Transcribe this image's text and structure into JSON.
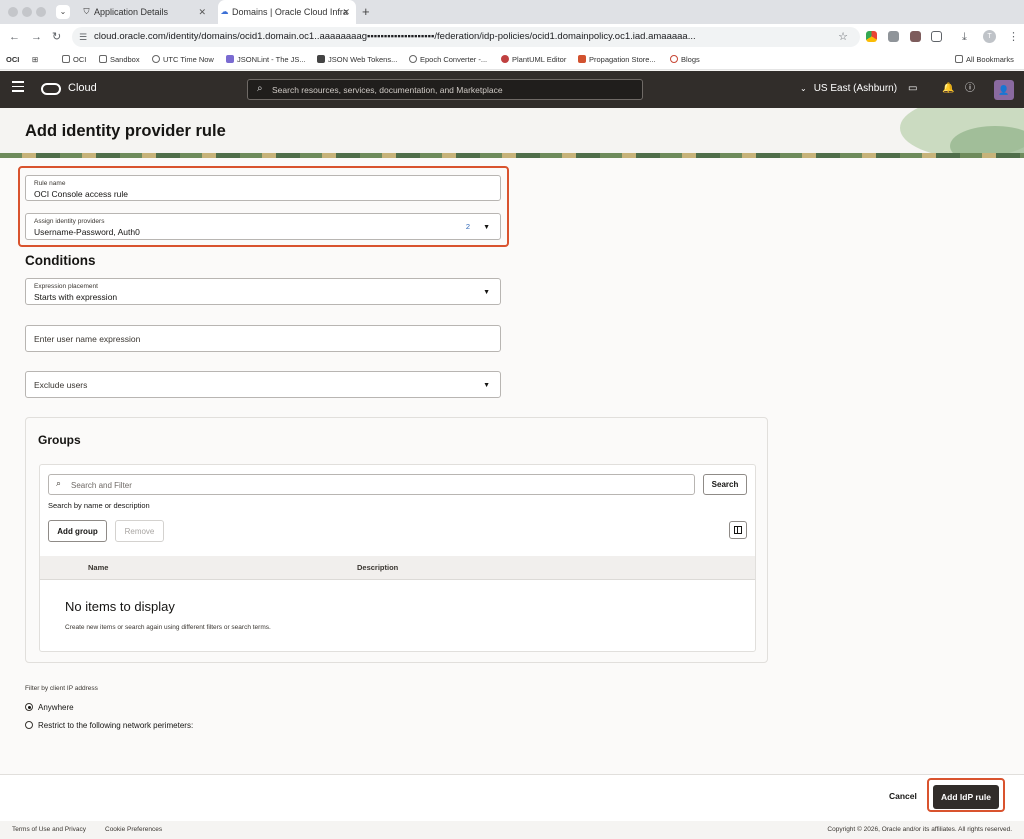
{
  "browser": {
    "tabs": [
      {
        "title": "Application Details",
        "icon": "shield-icon"
      },
      {
        "title": "Domains | Oracle Cloud Infra",
        "icon": "cloud-icon"
      }
    ],
    "url": "cloud.oracle.com/identity/domains/ocid1.domain.oc1..aaaaaaaag▪▪▪▪▪▪▪▪▪▪▪▪▪▪▪▪▪▪▪▪/federation/idp-policies/ocid1.domainpolicy.oc1.iad.amaaaaa...",
    "bookmarks": [
      "OCI",
      "Sandbox",
      "UTC Time Now",
      "JSONLint - The JS...",
      "JSON Web Tokens...",
      "Epoch Converter -...",
      "PlantUML Editor",
      "Propagation Store...",
      "Blogs"
    ],
    "all_bookmarks": "All Bookmarks",
    "oci_badge": "OCI"
  },
  "header": {
    "brand": "Cloud",
    "search_placeholder": "Search resources, services, documentation, and Marketplace",
    "region": "US East (Ashburn)"
  },
  "page": {
    "title": "Add identity provider rule"
  },
  "form": {
    "rule_name": {
      "label": "Rule name",
      "value": "OCI Console access rule"
    },
    "identity_providers": {
      "label": "Assign identity providers",
      "value": "Username-Password, Auth0",
      "count": "2"
    },
    "conditions_heading": "Conditions",
    "expression_placement": {
      "label": "Expression placement",
      "value": "Starts with expression"
    },
    "user_name_expression": {
      "placeholder": "Enter user name expression"
    },
    "exclude_users": {
      "placeholder": "Exclude users"
    }
  },
  "groups": {
    "heading": "Groups",
    "search_placeholder": "Search and Filter",
    "search_button": "Search",
    "hint": "Search by name or description",
    "add_button": "Add group",
    "remove_button": "Remove",
    "columns": [
      "Name",
      "Description"
    ],
    "empty_title": "No items to display",
    "empty_sub": "Create new items or search again using different filters or search terms."
  },
  "ip_filter": {
    "label": "Filter by client IP address",
    "options": [
      {
        "label": "Anywhere",
        "selected": true
      },
      {
        "label": "Restrict to the following network perimeters:",
        "selected": false
      }
    ]
  },
  "footer": {
    "cancel": "Cancel",
    "submit": "Add IdP rule",
    "terms": "Terms of Use and Privacy",
    "cookies": "Cookie Preferences",
    "copyright": "Copyright © 2026, Oracle and/or its affiliates. All rights reserved."
  },
  "colors": {
    "header_bg": "#312d2a",
    "highlight": "#d9532e",
    "primary_button": "#312d2a"
  }
}
